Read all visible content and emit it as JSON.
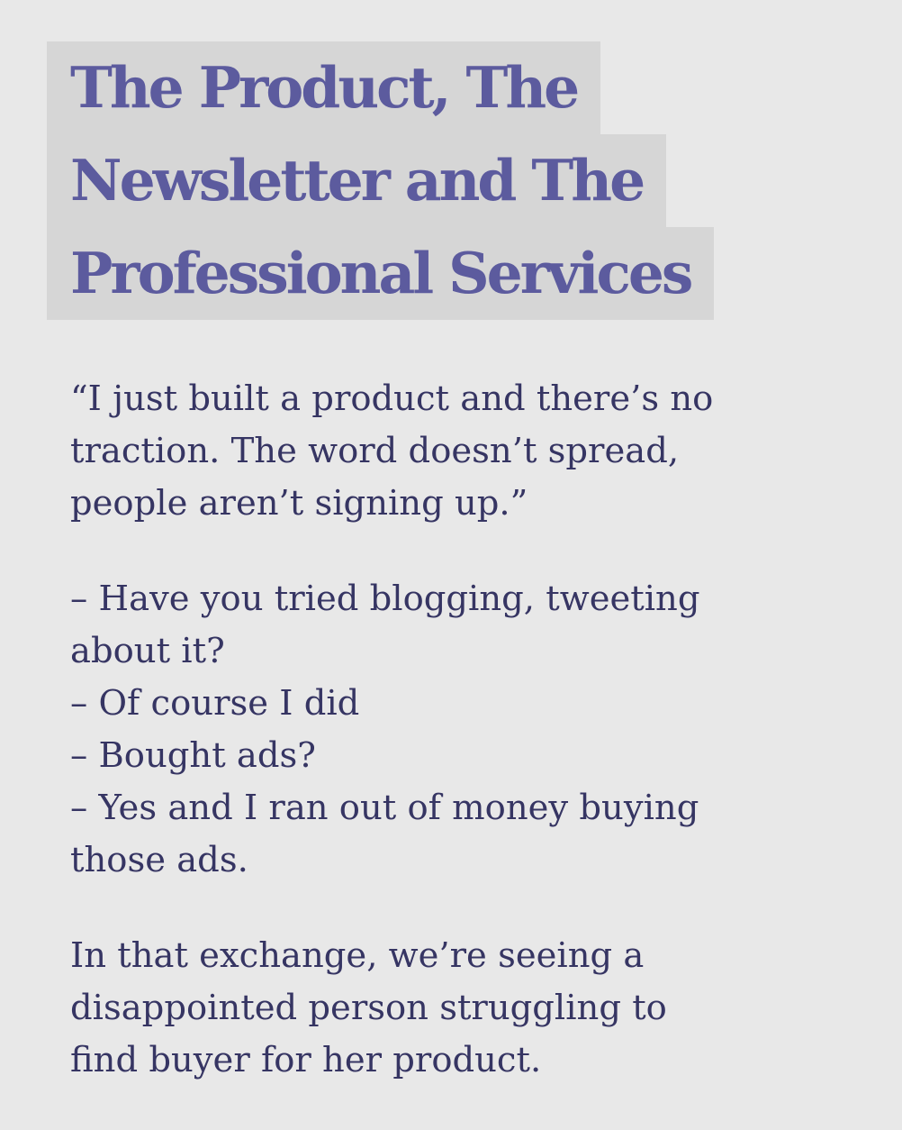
{
  "article": {
    "title_lines": [
      "The Product, The",
      "Newsletter and The",
      "Professional Services"
    ],
    "quote_lines": [
      "“I just built a product and there’s no",
      "traction. The word doesn’t spread,",
      "people aren’t signing up.”"
    ],
    "dialogue_lines": [
      "– Have you tried blogging, tweeting",
      "about it?",
      "– Of course I did",
      "– Bought ads?",
      "– Yes and I ran out of money buying",
      "those ads."
    ],
    "summary_lines": [
      "In that exchange, we’re seeing a",
      "disappointed person struggling to",
      "find buyer for her product."
    ]
  },
  "colors": {
    "page_background": "#e8e8e8",
    "title_highlight": "#d6d6d6",
    "title_text": "#5c5b9e",
    "body_text": "#363563"
  }
}
